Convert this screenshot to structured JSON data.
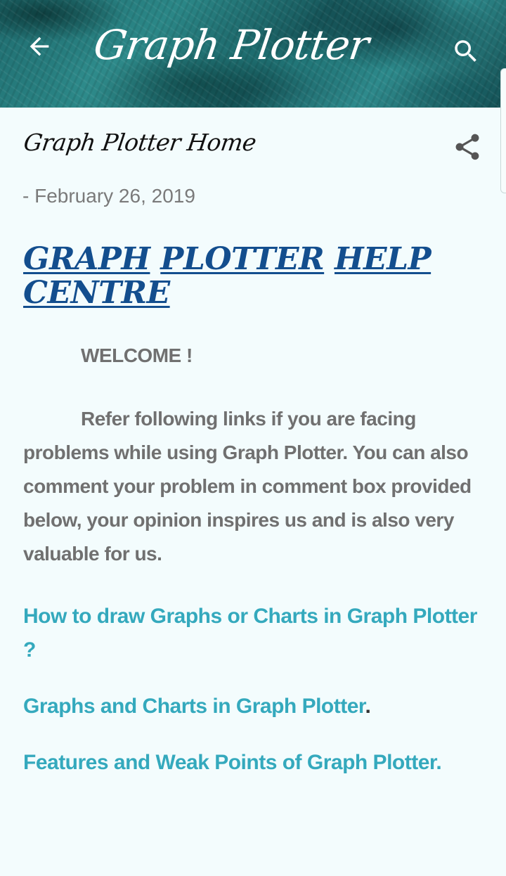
{
  "header": {
    "title": "Graph Plotter",
    "back_icon": "arrow-back-icon",
    "search_icon": "search-icon"
  },
  "post": {
    "title": "Graph Plotter Home",
    "date": "- February 26, 2019",
    "share_icon": "share-icon",
    "heading_words": [
      "GRAPH",
      "PLOTTER",
      "HELP",
      "CENTRE"
    ],
    "welcome": "WELCOME !",
    "intro": "Refer following links if you are facing problems while using Graph Plotter. You can also comment your problem in comment box provided below, your opinion inspires us and is also very valuable for us.",
    "links": [
      "How to draw Graphs or Charts in Graph Plotter ?",
      "Graphs and Charts in Graph Plotter",
      "Features and Weak Points of Graph Plotter."
    ],
    "link_2_suffix": "."
  },
  "colors": {
    "heading": "#134e8e",
    "link": "#34a9bd",
    "body_text": "#707070",
    "background": "#f3fcfd"
  }
}
